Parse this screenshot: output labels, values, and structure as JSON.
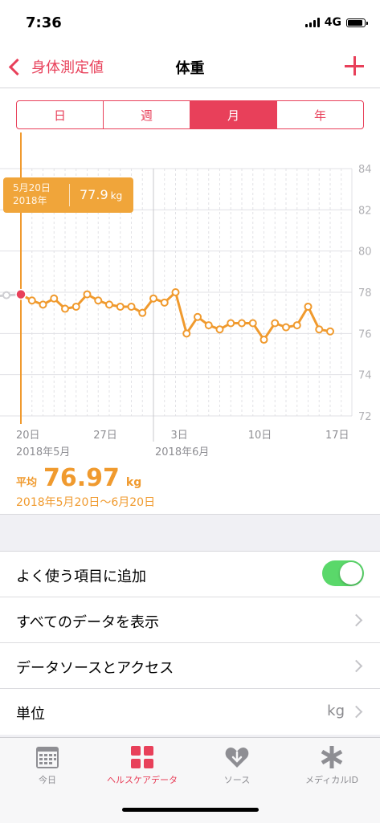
{
  "status": {
    "time": "7:36",
    "network": "4G"
  },
  "nav": {
    "back_label": "身体測定値",
    "title": "体重"
  },
  "segments": [
    {
      "label": "日",
      "active": false
    },
    {
      "label": "週",
      "active": false
    },
    {
      "label": "月",
      "active": true
    },
    {
      "label": "年",
      "active": false
    }
  ],
  "tooltip": {
    "date": "5月20日",
    "year": "2018年",
    "value": "77.9",
    "unit": "kg"
  },
  "summary": {
    "avg_label": "平均",
    "avg_value": "76.97",
    "unit": "kg",
    "range": "2018年5月20日〜6月20日"
  },
  "chart_data": {
    "type": "line",
    "y_ticks": [
      "84",
      "82",
      "80",
      "78",
      "76",
      "74",
      "72"
    ],
    "ylim": [
      72,
      84
    ],
    "x_ticks": [
      "20日",
      "27日",
      "3日",
      "10日",
      "17日"
    ],
    "month_labels": [
      "2018年5月",
      "2018年6月"
    ],
    "series": [
      {
        "values": [
          77.9,
          77.6,
          77.4,
          77.7,
          77.2,
          77.3,
          77.9,
          77.6,
          77.4,
          77.3,
          77.3,
          77.0,
          77.7,
          77.5,
          78.0,
          76.0,
          76.8,
          76.4,
          76.2,
          76.5,
          76.5,
          76.5,
          75.7,
          76.5,
          76.3,
          76.4,
          77.3,
          76.2,
          76.1
        ]
      }
    ],
    "colors": {
      "line": "#f09a2e",
      "selected": "#e8405a"
    }
  },
  "settings": {
    "favorite_label": "よく使う項目に追加",
    "show_all_label": "すべてのデータを表示",
    "sources_label": "データソースとアクセス",
    "unit_label": "単位",
    "unit_value": "kg"
  },
  "tabs": [
    {
      "label": "今日",
      "icon": "calendar-icon",
      "active": false
    },
    {
      "label": "ヘルスケアデータ",
      "icon": "grid-icon",
      "active": true
    },
    {
      "label": "ソース",
      "icon": "heart-download-icon",
      "active": false
    },
    {
      "label": "メディカルID",
      "icon": "asterisk-icon",
      "active": false
    }
  ]
}
